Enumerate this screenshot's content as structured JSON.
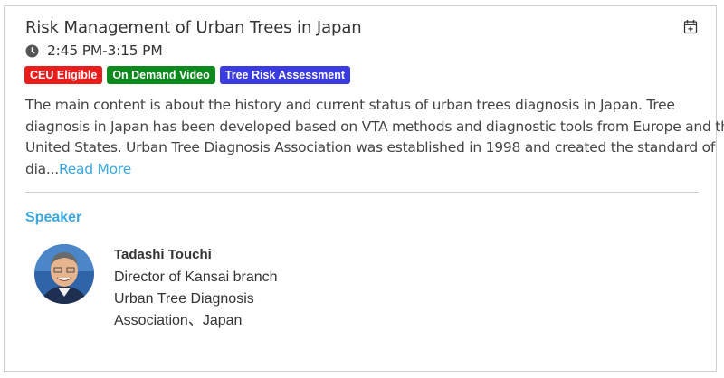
{
  "session": {
    "title": "Risk Management of Urban Trees in Japan",
    "time": "2:45 PM-3:15 PM",
    "calendar_icon": "calendar-plus-icon",
    "clock_icon": "clock-icon",
    "tags": [
      {
        "label": "CEU Eligible",
        "color": "#ea1c1c"
      },
      {
        "label": "On Demand Video",
        "color": "#0d8a1e"
      },
      {
        "label": "Tree Risk Assessment",
        "color": "#3a3be3"
      }
    ],
    "description_lines": [
      "The main content is about the history and current status of urban trees diagnosis in Japan. Tree",
      "diagnosis in Japan has been developed based on VTA methods and diagnostic tools from Europe and the",
      "United States. Urban Tree Diagnosis Association was established in 1998 and created the standard of",
      "dia..."
    ],
    "read_more": "Read More"
  },
  "speaker_section": {
    "heading": "Speaker",
    "speaker": {
      "name": "Tadashi Touchi",
      "role_lines": [
        "Director of Kansai branch",
        "Urban Tree Diagnosis",
        "Association、Japan"
      ]
    }
  },
  "colors": {
    "accent": "#3aa7e0",
    "text": "#333333",
    "divider": "#cfcfcf"
  }
}
